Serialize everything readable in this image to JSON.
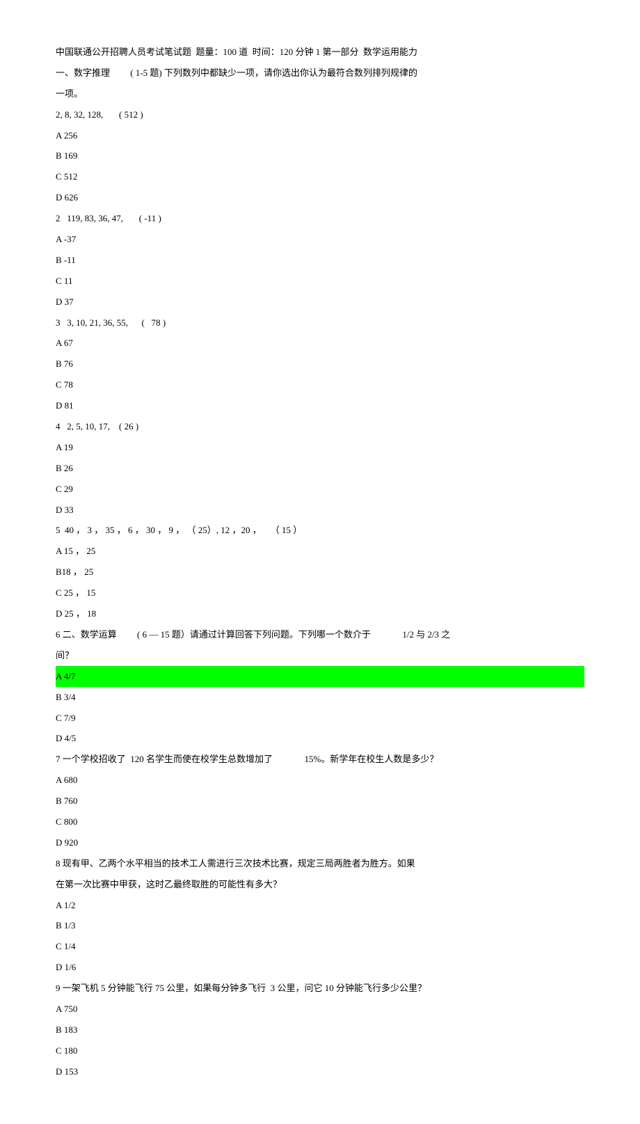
{
  "lines": [
    {
      "text": "中国联通公开招聘人员考试笔试题  题量：100 道  时间：120 分钟 1 第一部分  数学运用能力"
    },
    {
      "text": "一、数字推理         ( 1-5 题) 下列数列中都缺少一项，请你选出你认为最符合数列排列规律的"
    },
    {
      "text": "一项。"
    },
    {
      "text": "2, 8, 32, 128,       ( 512 )"
    },
    {
      "text": "A 256"
    },
    {
      "text": "B 169"
    },
    {
      "text": "C 512"
    },
    {
      "text": "D 626"
    },
    {
      "text": "2   119, 83, 36, 47,       ( -11 )"
    },
    {
      "text": "A -37"
    },
    {
      "text": "B -11"
    },
    {
      "text": "C 11"
    },
    {
      "text": "D 37"
    },
    {
      "text": "3   3, 10, 21, 36, 55,      (   78 )"
    },
    {
      "text": "A 67"
    },
    {
      "text": "B 76"
    },
    {
      "text": "C 78"
    },
    {
      "text": "D 81"
    },
    {
      "text": "4   2, 5, 10, 17,    ( 26 )"
    },
    {
      "text": "A 19"
    },
    {
      "text": "B 26"
    },
    {
      "text": "C 29"
    },
    {
      "text": "D 33"
    },
    {
      "text": "5  40 ， 3 ， 35 ， 6 ， 30 ， 9 ， （ 25）, 12 ，20 ，    （ 15 ）"
    },
    {
      "text": "A 15 ， 25"
    },
    {
      "text": "B18 ， 25"
    },
    {
      "text": "C 25 ， 15"
    },
    {
      "text": "D 25 ， 18"
    },
    {
      "text": "6 二、数学运算         ( 6 — 15 题）请通过计算回答下列问题。下列哪一个数介于              1/2 与 2/3 之"
    },
    {
      "text": "间？"
    },
    {
      "text": "A 4/7",
      "highlight": true
    },
    {
      "text": "B 3/4"
    },
    {
      "text": "C 7/9"
    },
    {
      "text": "D 4/5"
    },
    {
      "text": "7 一个学校招收了  120 名学生而使在校学生总数增加了              15%。新学年在校生人数是多少？"
    },
    {
      "text": "A 680"
    },
    {
      "text": "B 760"
    },
    {
      "text": "C 800"
    },
    {
      "text": "D 920"
    },
    {
      "text": "8 现有甲、乙两个水平相当的技术工人需进行三次技术比赛，规定三局两胜者为胜方。如果"
    },
    {
      "text": "在第一次比赛中甲获，这时乙最终取胜的可能性有多大？"
    },
    {
      "text": "A 1/2"
    },
    {
      "text": "B 1/3"
    },
    {
      "text": "C 1/4"
    },
    {
      "text": "D 1/6"
    },
    {
      "text": "9 一架飞机 5 分钟能飞行 75 公里，如果每分钟多飞行  3 公里，问它 10 分钟能飞行多少公里？"
    },
    {
      "text": "A 750"
    },
    {
      "text": "B 183"
    },
    {
      "text": "C 180"
    },
    {
      "text": "D 153"
    }
  ]
}
